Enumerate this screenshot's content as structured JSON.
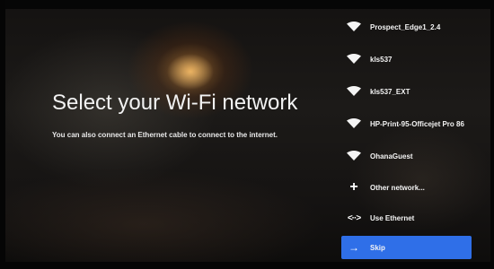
{
  "main": {
    "title": "Select your Wi-Fi network",
    "subtitle": "You can also connect an Ethernet cable to connect to the internet."
  },
  "networks": [
    {
      "name": "Prospect_Edge1_2.4",
      "icon": "wifi-icon"
    },
    {
      "name": "kls537",
      "icon": "wifi-icon"
    },
    {
      "name": "kls537_EXT",
      "icon": "wifi-icon"
    },
    {
      "name": "HP-Print-95-Officejet Pro 86",
      "icon": "wifi-icon"
    },
    {
      "name": "OhanaGuest",
      "icon": "wifi-icon"
    }
  ],
  "actions": {
    "other_network": "Other network...",
    "use_ethernet": "Use Ethernet",
    "skip": "Skip"
  },
  "icons": {
    "plus": "+",
    "ethernet": "<··>",
    "arrow": "→"
  },
  "colors": {
    "accent": "#2f6fe8",
    "text": "#f4f4f4"
  }
}
